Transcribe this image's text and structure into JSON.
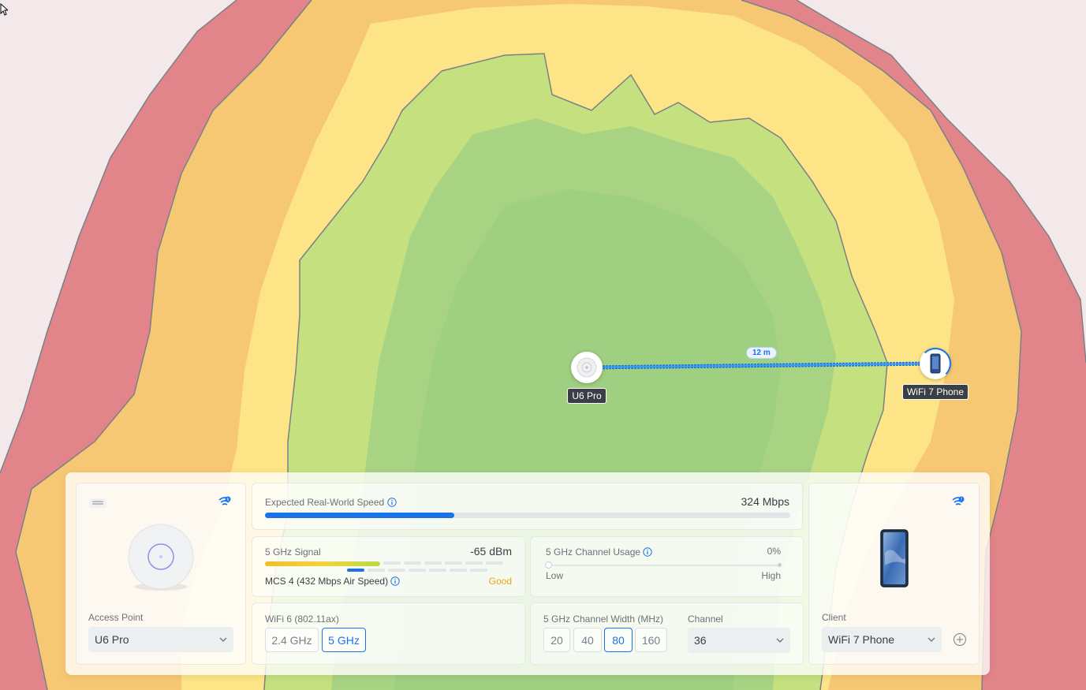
{
  "map": {
    "ap_label": "U6 Pro",
    "client_label": "WiFi 7 Phone",
    "distance": "12 m",
    "colors": {
      "excellent": "#a8d383",
      "good": "#c5e07f",
      "fair": "#fde486",
      "weak": "#f7c874",
      "poor": "#e2858a",
      "none": "#f3e9ea"
    }
  },
  "access_point": {
    "label": "Access Point",
    "value": "U6 Pro",
    "icons": [
      "ubiquiti-logo-icon",
      "wifi-6-icon",
      "chevron-down-icon"
    ]
  },
  "speed": {
    "label": "Expected Real-World Speed",
    "value": "324 Mbps",
    "fill_fraction": 0.36
  },
  "signal": {
    "label": "5 GHz Signal",
    "value": "-65 dBm",
    "mcs": "MCS 4 (432 Mbps Air Speed)",
    "quality": "Good",
    "quality_color": "#e8a317"
  },
  "channel_usage": {
    "label": "5 GHz Channel Usage",
    "value": "0%",
    "low": "Low",
    "high": "High"
  },
  "wifi_standard": {
    "label": "WiFi 6 (802.11ax)",
    "bands": [
      "2.4 GHz",
      "5 GHz"
    ],
    "selected_band": "5 GHz"
  },
  "channel_width": {
    "label": "5 GHz Channel Width (MHz)",
    "options": [
      "20",
      "40",
      "80",
      "160"
    ],
    "selected": "80",
    "channel_label": "Channel",
    "channel_value": "36"
  },
  "client": {
    "label": "Client",
    "value": "WiFi 7 Phone",
    "icons": [
      "wifi-7-icon",
      "add-circle-icon",
      "chevron-down-icon"
    ]
  },
  "accent": "#1a73e8"
}
